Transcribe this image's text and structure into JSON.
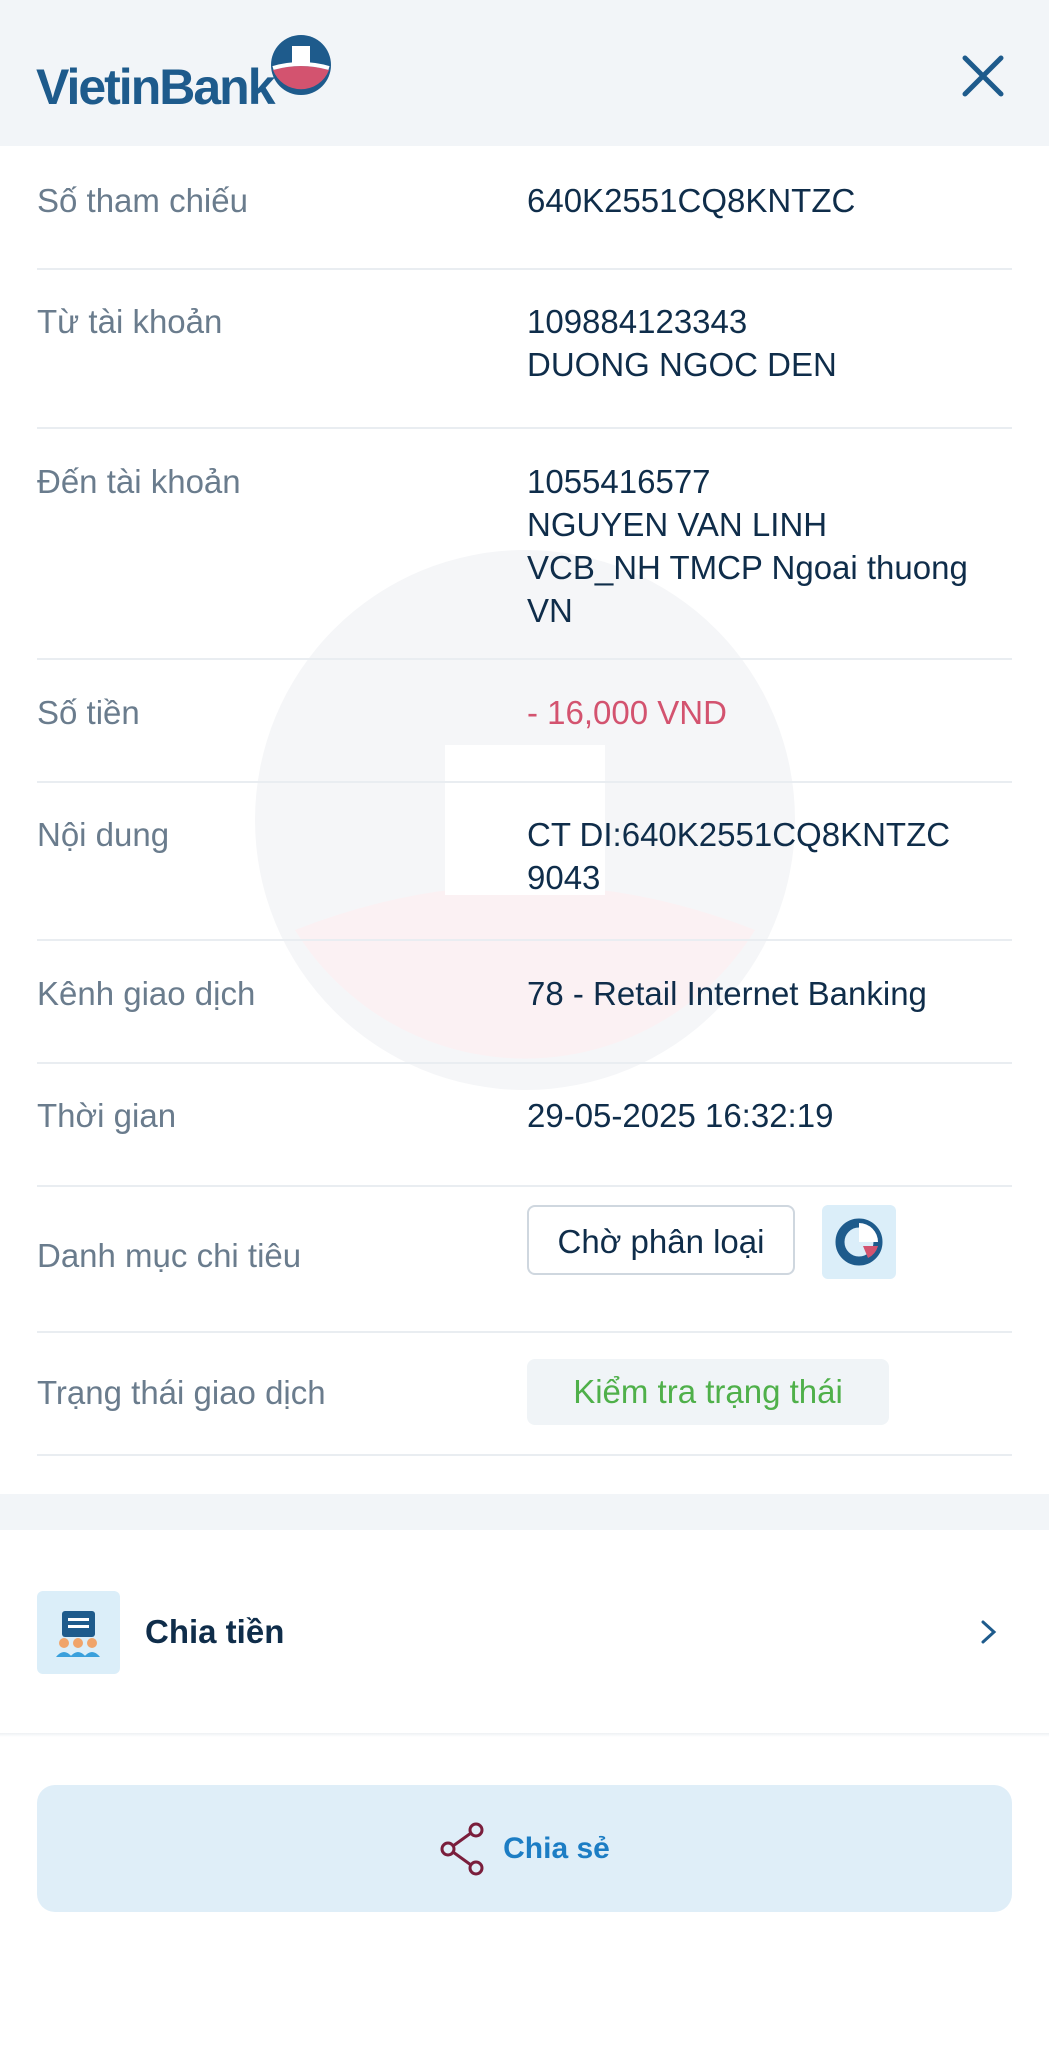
{
  "header": {
    "logo_text": "VietinBank",
    "close_icon": "close-icon"
  },
  "details": {
    "reference": {
      "label": "Số tham chiếu",
      "value": "640K2551CQ8KNTZC"
    },
    "from_account": {
      "label": "Từ tài khoản",
      "number": "109884123343",
      "name": "DUONG NGOC DEN"
    },
    "to_account": {
      "label": "Đến tài khoản",
      "number": "1055416577",
      "name": "NGUYEN VAN LINH",
      "bank_line1": "VCB_NH TMCP Ngoai thuong",
      "bank_line2": "VN"
    },
    "amount": {
      "label": "Số tiền",
      "value": "- 16,000 VND"
    },
    "content": {
      "label": "Nội dung",
      "line1": "CT DI:640K2551CQ8KNTZC",
      "line2": "9043"
    },
    "channel": {
      "label": "Kênh giao dịch",
      "value": "78 - Retail Internet Banking"
    },
    "time": {
      "label": "Thời gian",
      "value": "29-05-2025 16:32:19"
    },
    "category": {
      "label": "Danh mục chi tiêu",
      "chip": "Chờ phân loại",
      "icon": "pie-chart-icon"
    },
    "status": {
      "label": "Trạng thái giao dịch",
      "button": "Kiểm tra trạng thái"
    }
  },
  "split": {
    "label": "Chia tiền",
    "icon": "split-bill-icon"
  },
  "share": {
    "label": "Chia sẻ",
    "icon": "share-icon"
  },
  "colors": {
    "brand": "#1e5b8c",
    "amount": "#d3536f",
    "status_green": "#4fb04a",
    "share_blue": "#1c7dc4"
  }
}
